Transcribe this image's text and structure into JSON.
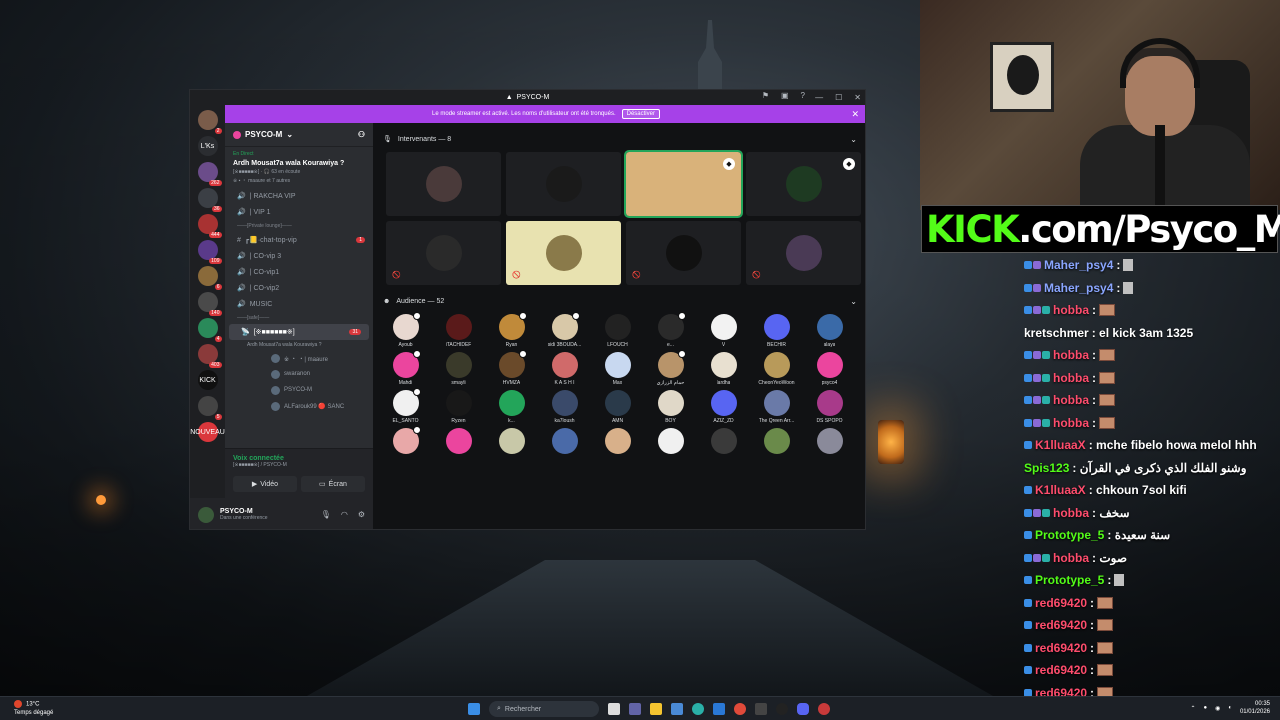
{
  "discord": {
    "window_title": "PSYCO-M",
    "banner": {
      "text": "Le mode streamer est activé. Les noms d'utilisateur ont été tronqués.",
      "button": "Désactiver"
    },
    "guilds": [
      {
        "badge": "2",
        "color": "#7a5c4a"
      },
      {
        "label": "L'Ks",
        "color": "#2b2d31"
      },
      {
        "badge": "262",
        "color": "#6b4c8a"
      },
      {
        "badge": "36",
        "color": "#3b3f45"
      },
      {
        "badge": "444",
        "color": "#a83232"
      },
      {
        "badge": "109",
        "color": "#5a3a8a"
      },
      {
        "badge": "6",
        "color": "#8a6a3a"
      },
      {
        "badge": "140",
        "color": "#4a4a4a"
      },
      {
        "badge": "4",
        "color": "#2a8a5a"
      },
      {
        "badge": "403",
        "color": "#8a3a3a"
      },
      {
        "label": "KICK",
        "color": "#101010"
      },
      {
        "badge": "5",
        "color": "#444"
      },
      {
        "label": "NOUVEAU",
        "color": "#da373c"
      }
    ],
    "server_name": "PSYCO-M",
    "live": {
      "label": "En Direct",
      "title": "Ardh Mousat7a wala Kourawiya ?",
      "listeners": "[※■■■■■※] · 🎧 63 en écoute",
      "sub": "※ ▪ ・ maaure et 7 autres"
    },
    "channels": [
      {
        "type": "voice",
        "name": "| RAKCHA VIP"
      },
      {
        "type": "voice",
        "name": "| VIP 1"
      },
      {
        "type": "category",
        "name": "——[Private lounge]——"
      },
      {
        "type": "text",
        "name": "┏📒·chat-top-vip",
        "badge": "1"
      },
      {
        "type": "voice",
        "name": "| CO-vip 3"
      },
      {
        "type": "voice",
        "name": "| CO-vip1"
      },
      {
        "type": "voice",
        "name": "| CO-vip2"
      },
      {
        "type": "voice",
        "name": "MUSIC"
      },
      {
        "type": "category",
        "name": "——[safe]——"
      },
      {
        "type": "stage",
        "name": "[※■■■■■■※]",
        "sub": "Ardh Mousat7a wala Kourawiya ?",
        "badge": "31",
        "active": true
      },
      {
        "type": "user",
        "name": "※ ・ ・| maaure"
      },
      {
        "type": "user",
        "name": "swaranon"
      },
      {
        "type": "user",
        "name": "PSYCO-M"
      },
      {
        "type": "user",
        "name": "ALFarouk99 🔴 SANC"
      }
    ],
    "voice_panel": {
      "status": "Voix connectée",
      "location": "[※■■■■■※] / PSYCO-M",
      "video": "Vidéo",
      "screen": "Écran"
    },
    "user_panel": {
      "name": "PSYCO-M",
      "status": "Dans une conférence"
    },
    "speakers_header": "Intervenants — 8",
    "speakers": [
      {
        "color": "#4a3a3a"
      },
      {
        "color": "#1a1a1a"
      },
      {
        "color": "#d9b27a",
        "speaking": true,
        "shield": true
      },
      {
        "color": "#1e3a22",
        "shield": true
      },
      {
        "color": "#2a2a2a",
        "muted": true
      },
      {
        "color": "#e8e2b0",
        "muted": true
      },
      {
        "color": "#111",
        "muted": true
      },
      {
        "color": "#4a3a55",
        "muted": true
      }
    ],
    "audience_header": "Audience — 52",
    "audience": [
      {
        "name": "Ayoub",
        "color": "#e8d8d0",
        "mod": true
      },
      {
        "name": "iTACHIDEF",
        "color": "#5a1a1a"
      },
      {
        "name": "Ryan",
        "color": "#c08a3a",
        "mod": true
      },
      {
        "name": "sidi 3BOUDA...",
        "color": "#d8c8a8",
        "mod": true
      },
      {
        "name": "LFOUCH",
        "color": "#222"
      },
      {
        "name": "e...",
        "color": "#2a2a2a",
        "mod": true
      },
      {
        "name": "V",
        "color": "#f2f2f2"
      },
      {
        "name": "BECHIR",
        "color": "#5865f2"
      },
      {
        "name": "alaya",
        "color": "#3a6aa8"
      },
      {
        "name": "Mahdi",
        "color": "#eb459e",
        "mod": true
      },
      {
        "name": "smayli",
        "color": "#3a3a2a"
      },
      {
        "name": "HVMZA",
        "color": "#6a4a2a",
        "mod": true
      },
      {
        "name": "K A S H I",
        "color": "#d06a6a"
      },
      {
        "name": "Max",
        "color": "#c8d8f0"
      },
      {
        "name": "حمام الزرازي",
        "color": "#b8946a",
        "mod": true
      },
      {
        "name": "lardha",
        "color": "#e8e0d0"
      },
      {
        "name": "CheonYeoWoon",
        "color": "#b89a5a"
      },
      {
        "name": "psyco4",
        "color": "#eb459e"
      },
      {
        "name": "EL_SANTO",
        "color": "#f0f0f0",
        "mod": true
      },
      {
        "name": "Ryzen",
        "color": "#181818"
      },
      {
        "name": "k...",
        "color": "#23a55a"
      },
      {
        "name": "ka7loush",
        "color": "#3a4a6a"
      },
      {
        "name": "AMN",
        "color": "#2a3a4a"
      },
      {
        "name": "BOY",
        "color": "#e0d8c8"
      },
      {
        "name": "AZIZ_ZD",
        "color": "#5865f2"
      },
      {
        "name": "The Qreen Arr...",
        "color": "#6a7aa8"
      },
      {
        "name": "DS SPOPO",
        "color": "#a83a8a"
      },
      {
        "name": "",
        "color": "#e8a8a8",
        "mod": true
      },
      {
        "name": "",
        "color": "#eb459e"
      },
      {
        "name": "",
        "color": "#c8c8a8"
      },
      {
        "name": "",
        "color": "#4a6aa8"
      },
      {
        "name": "",
        "color": "#d8b08a"
      },
      {
        "name": "",
        "color": "#f0f0f0"
      },
      {
        "name": "",
        "color": "#3a3a3a"
      },
      {
        "name": "",
        "color": "#6a8a4a"
      },
      {
        "name": "",
        "color": "#8a8a9a"
      }
    ]
  },
  "stream": {
    "kick_prefix": "KICK",
    "kick_suffix": ".com/Psyco_M",
    "chat": [
      {
        "user": "Maher_psy4",
        "color": "blue",
        "badges": 2,
        "text": "",
        "emote": "figure"
      },
      {
        "user": "Maher_psy4",
        "color": "blue",
        "badges": 2,
        "text": "",
        "emote": "figure"
      },
      {
        "user": "hobba",
        "color": "red",
        "badges": 3,
        "text": "",
        "emote": "box"
      },
      {
        "user": "kretschmer",
        "color": "white",
        "badges": 0,
        "text": ": el kick 3am 1325",
        "emote": ""
      },
      {
        "user": "hobba",
        "color": "red",
        "badges": 3,
        "text": "",
        "emote": "box"
      },
      {
        "user": "hobba",
        "color": "red",
        "badges": 3,
        "text": "",
        "emote": "box"
      },
      {
        "user": "hobba",
        "color": "red",
        "badges": 3,
        "text": "",
        "emote": "box"
      },
      {
        "user": "hobba",
        "color": "red",
        "badges": 3,
        "text": "",
        "emote": "box"
      },
      {
        "user": "K1lluaaX",
        "color": "red",
        "badges": 1,
        "text": ": mche fibelo howa melol hhh",
        "emote": ""
      },
      {
        "user": "Spis123",
        "color": "green",
        "badges": 0,
        "text": ": وشنو الفلك الذي ذكرى في القرآن",
        "emote": ""
      },
      {
        "user": "K1lluaaX",
        "color": "red",
        "badges": 1,
        "text": ": chkoun 7sol kifi",
        "emote": ""
      },
      {
        "user": "hobba",
        "color": "red",
        "badges": 3,
        "text": ": سخف",
        "emote": ""
      },
      {
        "user": "Prototype_5",
        "color": "green",
        "badges": 1,
        "text": ": سنة سعيدة",
        "emote": ""
      },
      {
        "user": "hobba",
        "color": "red",
        "badges": 3,
        "text": ": صوت",
        "emote": ""
      },
      {
        "user": "Prototype_5",
        "color": "green",
        "badges": 1,
        "text": "",
        "emote": "figure"
      },
      {
        "user": "red69420",
        "color": "red",
        "badges": 1,
        "text": "",
        "emote": "box"
      },
      {
        "user": "red69420",
        "color": "red",
        "badges": 1,
        "text": "",
        "emote": "box"
      },
      {
        "user": "red69420",
        "color": "red",
        "badges": 1,
        "text": "",
        "emote": "box"
      },
      {
        "user": "red69420",
        "color": "red",
        "badges": 1,
        "text": "",
        "emote": "box"
      },
      {
        "user": "red69420",
        "color": "red",
        "badges": 1,
        "text": "",
        "emote": "box"
      }
    ]
  },
  "taskbar": {
    "temperature": "13°C",
    "weather": "Temps dégagé",
    "search_placeholder": "Rechercher",
    "time": "00:35",
    "date": "01/01/2026"
  }
}
